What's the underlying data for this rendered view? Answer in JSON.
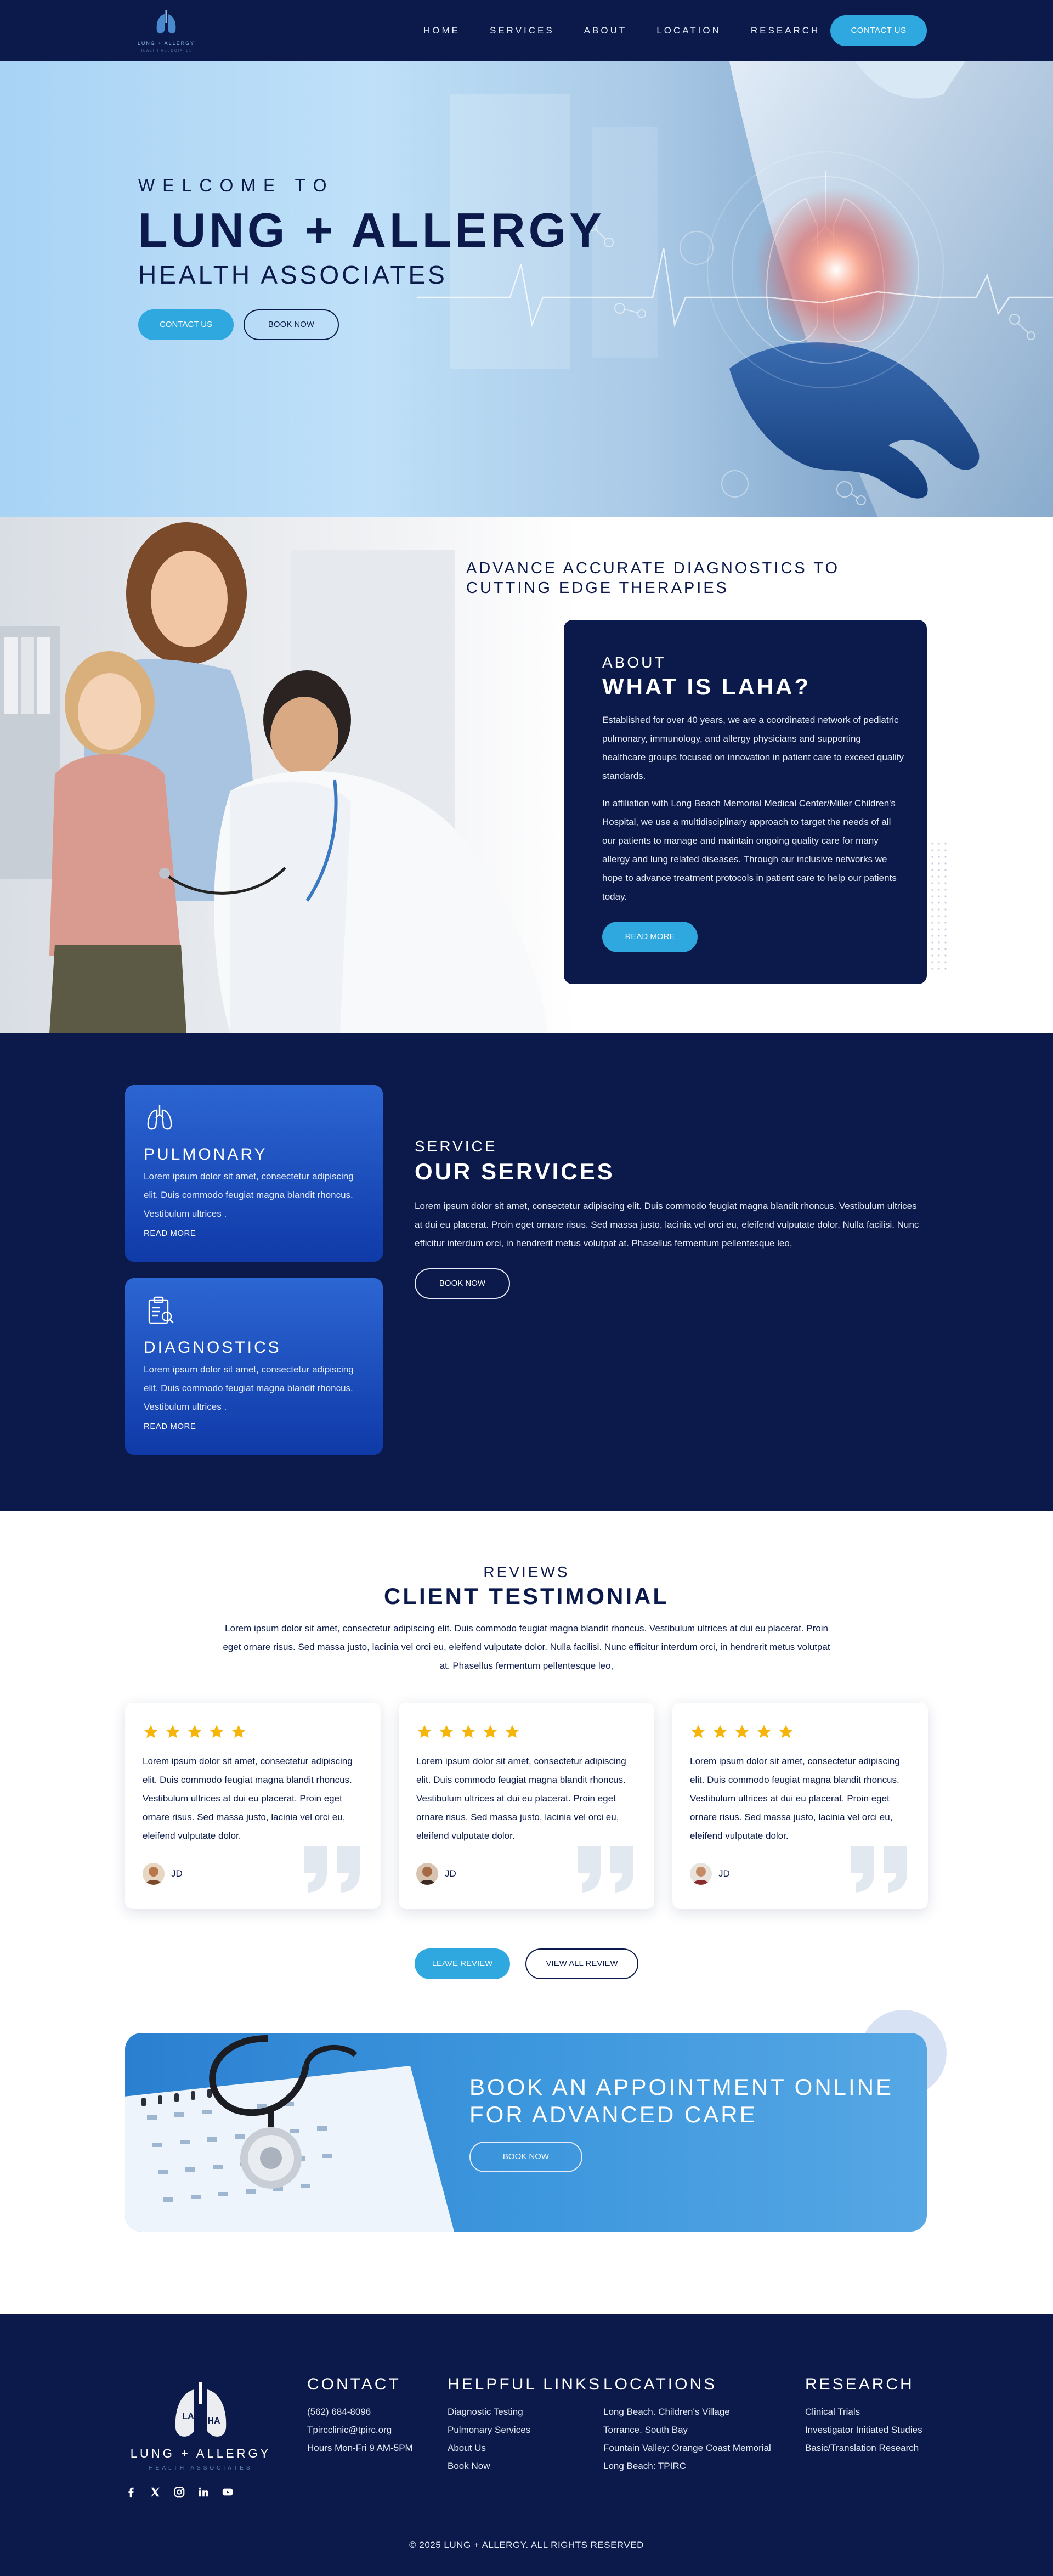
{
  "nav": {
    "logo_text": "LUNG + ALLERGY",
    "logo_sub": "HEALTH ASSOCIATES",
    "links": [
      "HOME",
      "SERVICES",
      "ABOUT",
      "LOCATION",
      "RESEARCH"
    ],
    "contact_label": "CONTACT US"
  },
  "hero": {
    "welcome": "WELCOME TO",
    "title": "LUNG + ALLERGY",
    "subtitle": "HEALTH ASSOCIATES",
    "btn_contact": "CONTACT US",
    "btn_book": "BOOK NOW"
  },
  "about": {
    "headline": "ADVANCE ACCURATE DIAGNOSTICS TO CUTTING EDGE THERAPIES",
    "kicker": "ABOUT",
    "title": "WHAT IS LAHA?",
    "p1": "Established for over 40 years, we are a coordinated network of pediatric pulmonary, immunology, and allergy physicians and supporting healthcare groups focused on  innovation in patient care to exceed quality standards.",
    "p2": "In affiliation with Long Beach Memorial Medical Center/Miller Children's Hospital, we use a multidisciplinary approach to target the needs of all our patients to manage and maintain ongoing quality care for many allergy and lung related diseases. Through our inclusive networks we hope to advance treatment protocols in patient care to help our patients today.",
    "btn": "READ MORE"
  },
  "services": {
    "cards": [
      {
        "icon": "lungs-icon",
        "name": "PULMONARY",
        "desc": "Lorem ipsum dolor sit amet, consectetur adipiscing elit. Duis commodo feugiat magna blandit rhoncus. Vestibulum ultrices .",
        "more": "READ MORE"
      },
      {
        "icon": "clipboard-icon",
        "name": "DIAGNOSTICS",
        "desc": "Lorem ipsum dolor sit amet, consectetur adipiscing elit. Duis commodo feugiat magna blandit rhoncus. Vestibulum ultrices .",
        "more": "READ MORE"
      }
    ],
    "kicker": "SERVICE",
    "title": "OUR SERVICES",
    "text": "Lorem ipsum dolor sit amet, consectetur adipiscing elit. Duis commodo feugiat magna blandit rhoncus. Vestibulum ultrices at dui eu placerat. Proin eget ornare risus. Sed massa justo, lacinia vel orci eu, eleifend vulputate dolor. Nulla facilisi. Nunc efficitur interdum orci, in hendrerit metus volutpat at. Phasellus fermentum pellentesque leo,",
    "btn": "BOOK NOW"
  },
  "reviews": {
    "kicker": "REVIEWS",
    "title": "CLIENT TESTIMONIAL",
    "intro": "Lorem ipsum dolor sit amet, consectetur adipiscing elit. Duis commodo feugiat magna blandit rhoncus. Vestibulum ultrices at dui eu placerat. Proin eget ornare risus. Sed massa justo, lacinia vel orci eu, eleifend vulputate dolor. Nulla facilisi. Nunc efficitur interdum orci, in hendrerit metus volutpat at. Phasellus fermentum pellentesque leo,",
    "items": [
      {
        "stars": 5,
        "text": "Lorem ipsum dolor sit amet, consectetur adipiscing elit. Duis commodo feugiat magna blandit rhoncus. Vestibulum ultrices at dui eu placerat. Proin eget ornare risus. Sed massa justo, lacinia vel orci eu, eleifend vulputate dolor.",
        "name": "JD"
      },
      {
        "stars": 5,
        "text": "Lorem ipsum dolor sit amet, consectetur adipiscing elit. Duis commodo feugiat magna blandit rhoncus. Vestibulum ultrices at dui eu placerat. Proin eget ornare risus. Sed massa justo, lacinia vel orci eu, eleifend vulputate dolor.",
        "name": "JD"
      },
      {
        "stars": 5,
        "text": "Lorem ipsum dolor sit amet, consectetur adipiscing elit. Duis commodo feugiat magna blandit rhoncus. Vestibulum ultrices at dui eu placerat. Proin eget ornare risus. Sed massa justo, lacinia vel orci eu, eleifend vulputate dolor.",
        "name": "JD"
      }
    ],
    "btn_leave": "LEAVE REVIEW",
    "btn_view": "VIEW ALL REVIEW"
  },
  "cta": {
    "title": "BOOK AN APPOINTMENT ONLINE FOR ADVANCED CARE",
    "btn": "BOOK NOW"
  },
  "footer": {
    "logo_text": "LUNG + ALLERGY",
    "logo_sub": "HEALTH ASSOCIATES",
    "logo_la": "LA",
    "logo_ha": "HA",
    "contact": {
      "heading": "CONTACT",
      "items": [
        "(562) 684-8096",
        "Tpircclinic@tpirc.org",
        "Hours Mon-Fri 9 AM-5PM"
      ]
    },
    "links": {
      "heading": "HELPFUL LINKS",
      "items": [
        "Diagnostic Testing",
        "Pulmonary Services",
        "About Us",
        "Book Now"
      ]
    },
    "locations": {
      "heading": "LOCATIONS",
      "items": [
        "Long Beach. Children's Village",
        "Torrance. South Bay",
        "Fountain Valley: Orange Coast Memorial",
        "Long Beach: TPIRC"
      ]
    },
    "research": {
      "heading": "RESEARCH",
      "items": [
        "Clinical Trials",
        "Investigator Initiated Studies",
        "Basic/Translation Research"
      ]
    },
    "social": [
      "facebook-icon",
      "x-icon",
      "instagram-icon",
      "linkedin-icon",
      "youtube-icon"
    ],
    "copyright": "© 2025 LUNG + ALLERGY. ALL RIGHTS RESERVED"
  },
  "colors": {
    "navy": "#0b1a4a",
    "accent": "#2fa8e0",
    "card_blue": "#1f55c4",
    "star": "#f5b50a"
  }
}
